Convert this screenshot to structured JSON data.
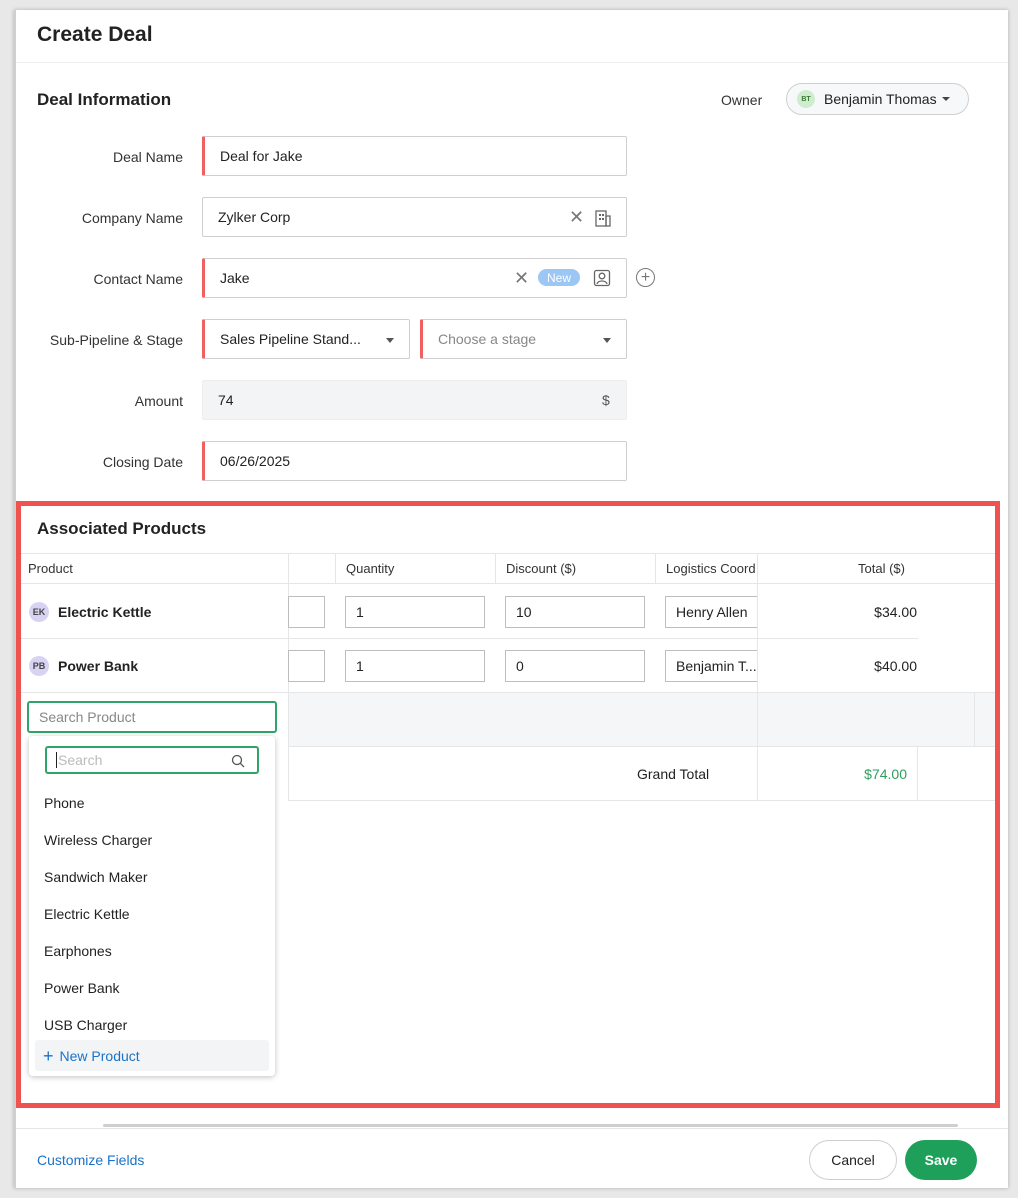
{
  "header": {
    "title": "Create Deal"
  },
  "deal_info": {
    "title": "Deal Information",
    "owner_label": "Owner",
    "owner_initials": "BT",
    "owner_name": "Benjamin Thomas",
    "fields": {
      "deal_name": {
        "label": "Deal Name",
        "value": "Deal for Jake"
      },
      "company_name": {
        "label": "Company Name",
        "value": "Zylker Corp"
      },
      "contact_name": {
        "label": "Contact Name",
        "value": "Jake",
        "badge": "New"
      },
      "pipeline": {
        "label": "Sub-Pipeline & Stage",
        "value": "Sales Pipeline Stand...",
        "stage_placeholder": "Choose a stage"
      },
      "amount": {
        "label": "Amount",
        "value": "74",
        "currency": "$"
      },
      "closing_date": {
        "label": "Closing Date",
        "value": "06/26/2025"
      }
    }
  },
  "products": {
    "title": "Associated Products",
    "columns": [
      "Product",
      "Quantity",
      "Discount ($)",
      "Logistics Coord",
      "Total ($)"
    ],
    "rows": [
      {
        "initials": "EK",
        "name": "Electric Kettle",
        "quantity": "1",
        "discount": "10",
        "coordinator": "Henry Allen",
        "total": "$34.00"
      },
      {
        "initials": "PB",
        "name": "Power Bank",
        "quantity": "1",
        "discount": "0",
        "coordinator": "Benjamin T...",
        "total": "$40.00"
      }
    ],
    "search_placeholder": "Search Product",
    "grand_total_label": "Grand Total",
    "grand_total_value": "$74.00"
  },
  "dropdown": {
    "search_placeholder": "Search",
    "items": [
      "Phone",
      "Wireless Charger",
      "Sandwich Maker",
      "Electric Kettle",
      "Earphones",
      "Power Bank",
      "USB Charger"
    ],
    "new_product": "New Product"
  },
  "footer": {
    "customize": "Customize Fields",
    "cancel": "Cancel",
    "save": "Save"
  },
  "colors": {
    "mandatory": "#f06060",
    "highlight_frame": "#ef5350",
    "save": "#1ea05a",
    "link": "#1a73c8",
    "grand_total": "#2e9e5e"
  }
}
